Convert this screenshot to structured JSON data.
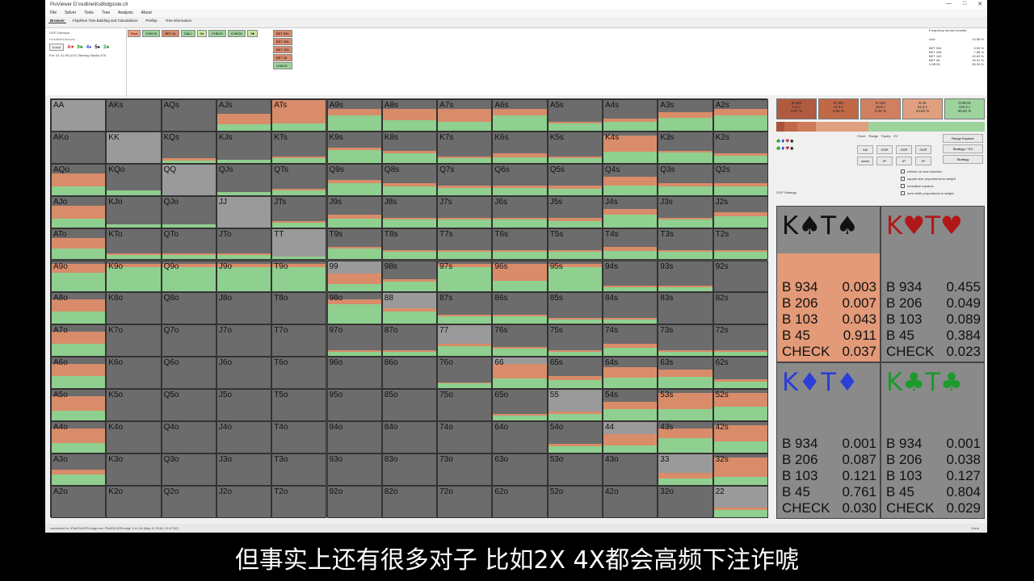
{
  "window": {
    "title": "PioViewer D:\\redline\\Ks8bdgsiste.cfr",
    "controls": [
      "—",
      "□",
      "✕"
    ]
  },
  "menu": [
    "File",
    "Solver",
    "Tools",
    "Tree",
    "Analysis",
    "About"
  ],
  "tabs": [
    "Browser",
    "Flop/Run Tree Building and Calculations",
    "Preflop",
    "Tree information"
  ],
  "left_info": {
    "line1": "OOP Decision",
    "line2": "r:0:c:b14:c:b:c:c:b",
    "board_button": "board",
    "board_cards": [
      "A♥",
      "9♣",
      "4♦",
      "5♠",
      "2♣"
    ],
    "pot_line": "Pot: 41 41 58 (157) Starting Stacks 876"
  },
  "action_sequence": [
    "Root",
    "CHECK",
    "BET 41",
    "CALL",
    "5♦",
    "CHECK",
    "CHECK",
    "2♣"
  ],
  "action_options": [
    "BET 934",
    "BET 206",
    "BET 103",
    "BET 45",
    "CHECK"
  ],
  "frequencies": {
    "header": "Frequency across runouts",
    "rows": [
      {
        "label": "Line",
        "value": "10.58 %"
      },
      {
        "label": "BET 934",
        "value": "0.09 %"
      },
      {
        "label": "BET 206",
        "value": "7.88 %"
      },
      {
        "label": "BET 103",
        "value": "10.63 %"
      },
      {
        "label": "BET 45",
        "value": "25.31 %"
      },
      {
        "label": "CHECK",
        "value": "55.33 %"
      }
    ]
  },
  "colors": {
    "bet": "#d98c6a",
    "check": "#8fcf8f",
    "neutral": "#7a7a7a"
  },
  "summary": [
    {
      "label": "B 934",
      "combos": "6.3 c",
      "pct": "3.97 %"
    },
    {
      "label": "B 206",
      "combos": "11.9 c",
      "pct": "5.56 %"
    },
    {
      "label": "B 103",
      "combos": "16.5 c",
      "pct": "9.25 %"
    },
    {
      "label": "B 45",
      "combos": "51.5 c",
      "pct": "24.62 %"
    },
    {
      "label": "CHECK",
      "combos": "118.3 c",
      "pct": "56.60 %"
    }
  ],
  "controls": {
    "labels": [
      "Clone",
      "Range",
      "Equity",
      "EV"
    ],
    "buttons": [
      "full",
      "OOP",
      "OOP",
      "OOP",
      "zoom",
      "IP",
      "IP",
      "IP"
    ],
    "side": [
      "Range Explorer",
      "Strategy + EV",
      "Strategy"
    ],
    "strategy_label": "OOP Strategy",
    "checkboxes": [
      "refresh on new selection",
      "square size proportional to weight",
      "normalize squares",
      "bars width proportional to weight"
    ]
  },
  "combos": [
    {
      "cards": "K♠T♠",
      "color": "#111111",
      "fill": 1.0,
      "rows": [
        [
          "B 934",
          "0.003"
        ],
        [
          "B 206",
          "0.007"
        ],
        [
          "B 103",
          "0.043"
        ],
        [
          "B 45",
          "0.911"
        ],
        [
          "CHECK",
          "0.037"
        ]
      ]
    },
    {
      "cards": "K♥T♥",
      "color": "#b01818",
      "fill": 0.0,
      "rows": [
        [
          "B 934",
          "0.455"
        ],
        [
          "B 206",
          "0.049"
        ],
        [
          "B 103",
          "0.089"
        ],
        [
          "B 45",
          "0.384"
        ],
        [
          "CHECK",
          "0.023"
        ]
      ]
    },
    {
      "cards": "K♦T♦",
      "color": "#2a3fd6",
      "fill": 0.0,
      "rows": [
        [
          "B 934",
          "0.001"
        ],
        [
          "B 206",
          "0.087"
        ],
        [
          "B 103",
          "0.121"
        ],
        [
          "B 45",
          "0.761"
        ],
        [
          "CHECK",
          "0.030"
        ]
      ]
    },
    {
      "cards": "K♣T♣",
      "color": "#1c9a2c",
      "fill": 0.0,
      "rows": [
        [
          "B 934",
          "0.001"
        ],
        [
          "B 206",
          "0.038"
        ],
        [
          "B 103",
          "0.127"
        ],
        [
          "B 45",
          "0.804"
        ],
        [
          "CHECK",
          "0.029"
        ]
      ]
    }
  ],
  "grid": {
    "ranks": [
      "A",
      "K",
      "Q",
      "J",
      "T",
      "9",
      "8",
      "7",
      "6",
      "5",
      "4",
      "3",
      "2"
    ],
    "cells": [
      [
        "AA",
        "AKs",
        "AQs",
        "AJs",
        "ATs",
        "A9s",
        "A8s",
        "A7s",
        "A6s",
        "A5s",
        "A4s",
        "A3s",
        "A2s"
      ],
      [
        "AKo",
        "KK",
        "KQs",
        "KJs",
        "KTs",
        "K9s",
        "K8s",
        "K7s",
        "K6s",
        "K5s",
        "K4s",
        "K3s",
        "K2s"
      ],
      [
        "AQo",
        "KQo",
        "QQ",
        "QJs",
        "QTs",
        "Q9s",
        "Q8s",
        "Q7s",
        "Q6s",
        "Q5s",
        "Q4s",
        "Q3s",
        "Q2s"
      ],
      [
        "AJo",
        "KJo",
        "QJo",
        "JJ",
        "JTs",
        "J9s",
        "J8s",
        "J7s",
        "J6s",
        "J5s",
        "J4s",
        "J3s",
        "J2s"
      ],
      [
        "ATo",
        "KTo",
        "QTo",
        "JTo",
        "TT",
        "T9s",
        "T8s",
        "T7s",
        "T6s",
        "T5s",
        "T4s",
        "T3s",
        "T2s"
      ],
      [
        "A9o",
        "K9o",
        "Q9o",
        "J9o",
        "T9o",
        "99",
        "98s",
        "97s",
        "96s",
        "95s",
        "94s",
        "93s",
        "92s"
      ],
      [
        "A8o",
        "K8o",
        "Q8o",
        "J8o",
        "T8o",
        "98o",
        "88",
        "87s",
        "86s",
        "85s",
        "84s",
        "83s",
        "82s"
      ],
      [
        "A7o",
        "K7o",
        "Q7o",
        "J7o",
        "T7o",
        "97o",
        "87o",
        "77",
        "76s",
        "75s",
        "74s",
        "73s",
        "72s"
      ],
      [
        "A6o",
        "K6o",
        "Q6o",
        "J6o",
        "T6o",
        "96o",
        "86o",
        "76o",
        "66",
        "65s",
        "64s",
        "63s",
        "62s"
      ],
      [
        "A5o",
        "K5o",
        "Q5o",
        "J5o",
        "T5o",
        "95o",
        "85o",
        "75o",
        "65o",
        "55",
        "54s",
        "53s",
        "52s"
      ],
      [
        "A4o",
        "K4o",
        "Q4o",
        "J4o",
        "T4o",
        "94o",
        "84o",
        "74o",
        "64o",
        "54o",
        "44",
        "43s",
        "42s"
      ],
      [
        "A3o",
        "K3o",
        "Q3o",
        "J3o",
        "T3o",
        "93o",
        "83o",
        "73o",
        "63o",
        "53o",
        "43o",
        "33",
        "32s"
      ],
      [
        "A2o",
        "K2o",
        "Q2o",
        "J2o",
        "T2o",
        "92o",
        "82o",
        "72o",
        "62o",
        "52o",
        "42o",
        "32o",
        "22"
      ]
    ],
    "mix": [
      [
        [
          0,
          0,
          0
        ],
        [
          0,
          0,
          0
        ],
        [
          0,
          0,
          0
        ],
        [
          0.6,
          0.4,
          0.55
        ],
        [
          1,
          0.3,
          1
        ],
        [
          0.3,
          0.7,
          0.7
        ],
        [
          0.5,
          0.5,
          0.7
        ],
        [
          0.6,
          0.4,
          0.7
        ],
        [
          0.3,
          0.7,
          0.7
        ],
        [
          0.2,
          0.6,
          0.3
        ],
        [
          0.2,
          0.6,
          0.4
        ],
        [
          0.3,
          0.7,
          0.6
        ],
        [
          0.3,
          0.7,
          0.7
        ]
      ],
      [
        [
          0,
          0,
          0
        ],
        [
          0,
          0,
          0
        ],
        [
          0.1,
          0.1,
          0.15
        ],
        [
          0,
          0.1,
          0.1
        ],
        [
          0.2,
          0.8,
          0.2
        ],
        [
          0.1,
          0.6,
          0.5
        ],
        [
          0.2,
          0.6,
          0.4
        ],
        [
          0.1,
          0.3,
          0.2
        ],
        [
          0.2,
          0.3,
          0.3
        ],
        [
          0.1,
          0.3,
          0.2
        ],
        [
          0.6,
          0.4,
          0.9
        ],
        [
          0.1,
          0.5,
          0.4
        ],
        [
          0.1,
          0.4,
          0.3
        ]
      ],
      [
        [
          0.6,
          0.4,
          0.7
        ],
        [
          0,
          0.1,
          0.15
        ],
        [
          0,
          0,
          0
        ],
        [
          0,
          0.1,
          0.1
        ],
        [
          0.1,
          0.3,
          0.2
        ],
        [
          0.2,
          0.6,
          0.5
        ],
        [
          0.2,
          0.5,
          0.4
        ],
        [
          0.1,
          0.4,
          0.3
        ],
        [
          0.1,
          0.4,
          0.3
        ],
        [
          0.2,
          0.4,
          0.3
        ],
        [
          0.5,
          0.5,
          0.6
        ],
        [
          0.2,
          0.5,
          0.4
        ],
        [
          0.2,
          0.5,
          0.4
        ]
      ],
      [
        [
          0.6,
          0.4,
          0.7
        ],
        [
          0,
          0.1,
          0.1
        ],
        [
          0,
          0.1,
          0.1
        ],
        [
          0,
          0,
          0
        ],
        [
          0.1,
          0.3,
          0.2
        ],
        [
          0.2,
          0.5,
          0.4
        ],
        [
          0.1,
          0.4,
          0.3
        ],
        [
          0.1,
          0.4,
          0.3
        ],
        [
          0.1,
          0.4,
          0.3
        ],
        [
          0.2,
          0.4,
          0.3
        ],
        [
          0.3,
          0.6,
          0.6
        ],
        [
          0.1,
          0.4,
          0.3
        ],
        [
          0.2,
          0.5,
          0.5
        ]
      ],
      [
        [
          0.5,
          0.5,
          0.7
        ],
        [
          0.1,
          0.2,
          0.2
        ],
        [
          0.1,
          0.2,
          0.2
        ],
        [
          0.1,
          0.2,
          0.2
        ],
        [
          0,
          0.1,
          0.1
        ],
        [
          0.1,
          0.6,
          0.4
        ],
        [
          0.1,
          0.5,
          0.3
        ],
        [
          0.1,
          0.4,
          0.3
        ],
        [
          0.1,
          0.5,
          0.3
        ],
        [
          0.1,
          0.4,
          0.3
        ],
        [
          0.2,
          0.5,
          0.4
        ],
        [
          0.1,
          0.4,
          0.3
        ],
        [
          0.1,
          0.5,
          0.3
        ]
      ],
      [
        [
          0.3,
          0.7,
          0.9
        ],
        [
          0.1,
          0.9,
          0.9
        ],
        [
          0.1,
          0.9,
          0.9
        ],
        [
          0.1,
          0.9,
          0.9
        ],
        [
          0.1,
          0.9,
          0.9
        ],
        [
          0.4,
          0.3,
          0.6
        ],
        [
          0.1,
          0.5,
          0.4
        ],
        [
          0.1,
          0.8,
          0.9
        ],
        [
          0.6,
          0.4,
          0.9
        ],
        [
          0.1,
          0.8,
          0.9
        ],
        [
          0.1,
          0.3,
          0.2
        ],
        [
          0.1,
          0.3,
          0.2
        ],
        [
          0,
          0,
          0
        ]
      ],
      [
        [
          0.5,
          0.5,
          0.8
        ],
        [
          0,
          0,
          0
        ],
        [
          0,
          0,
          0
        ],
        [
          0,
          0,
          0
        ],
        [
          0,
          0,
          0
        ],
        [
          0.2,
          0.8,
          0.8
        ],
        [
          0.1,
          0.5,
          0.5
        ],
        [
          0.1,
          0.4,
          0.3
        ],
        [
          0.1,
          0.4,
          0.3
        ],
        [
          0.1,
          0.3,
          0.2
        ],
        [
          0.1,
          0.3,
          0.2
        ],
        [
          0,
          0,
          0
        ],
        [
          0,
          0,
          0
        ]
      ],
      [
        [
          0.5,
          0.5,
          0.8
        ],
        [
          0,
          0,
          0
        ],
        [
          0,
          0,
          0
        ],
        [
          0,
          0,
          0
        ],
        [
          0,
          0,
          0
        ],
        [
          0.1,
          0.2,
          0.2
        ],
        [
          0.1,
          0.2,
          0.2
        ],
        [
          0.1,
          0.5,
          0.4
        ],
        [
          0.1,
          0.4,
          0.3
        ],
        [
          0.1,
          0.3,
          0.2
        ],
        [
          0.2,
          0.4,
          0.4
        ],
        [
          0.1,
          0.3,
          0.2
        ],
        [
          0.1,
          0.3,
          0.2
        ]
      ],
      [
        [
          0.5,
          0.5,
          0.8
        ],
        [
          0,
          0,
          0
        ],
        [
          0,
          0,
          0
        ],
        [
          0,
          0,
          0
        ],
        [
          0,
          0,
          0
        ],
        [
          0,
          0,
          0
        ],
        [
          0,
          0,
          0
        ],
        [
          0.1,
          0.3,
          0.2
        ],
        [
          0.6,
          0.4,
          0.8
        ],
        [
          0.2,
          0.4,
          0.4
        ],
        [
          0.5,
          0.5,
          0.7
        ],
        [
          0.4,
          0.6,
          0.6
        ],
        [
          0.2,
          0.5,
          0.3
        ]
      ],
      [
        [
          0.6,
          0.4,
          0.8
        ],
        [
          0,
          0,
          0
        ],
        [
          0,
          0,
          0
        ],
        [
          0,
          0,
          0
        ],
        [
          0,
          0,
          0
        ],
        [
          0,
          0,
          0
        ],
        [
          0,
          0,
          0
        ],
        [
          0,
          0,
          0
        ],
        [
          0.1,
          0.3,
          0.2
        ],
        [
          0.2,
          0.4,
          0.3
        ],
        [
          0.4,
          0.6,
          0.6
        ],
        [
          0.6,
          0.4,
          0.9
        ],
        [
          0.5,
          0.5,
          0.9
        ]
      ],
      [
        [
          0.6,
          0.4,
          0.8
        ],
        [
          0,
          0,
          0
        ],
        [
          0,
          0,
          0
        ],
        [
          0,
          0,
          0
        ],
        [
          0,
          0,
          0
        ],
        [
          0,
          0,
          0
        ],
        [
          0,
          0,
          0
        ],
        [
          0,
          0,
          0
        ],
        [
          0,
          0,
          0
        ],
        [
          0.2,
          0.4,
          0.3
        ],
        [
          0.6,
          0.4,
          0.6
        ],
        [
          0.4,
          0.6,
          0.8
        ],
        [
          0.6,
          0.4,
          0.9
        ]
      ],
      [
        [
          0.3,
          0.7,
          0.5
        ],
        [
          0,
          0,
          0
        ],
        [
          0,
          0,
          0
        ],
        [
          0,
          0,
          0
        ],
        [
          0,
          0,
          0
        ],
        [
          0,
          0,
          0
        ],
        [
          0,
          0,
          0
        ],
        [
          0,
          0,
          0
        ],
        [
          0,
          0,
          0
        ],
        [
          0,
          0,
          0
        ],
        [
          0,
          0,
          0
        ],
        [
          0.3,
          0.3,
          0.4
        ],
        [
          0.7,
          0.3,
          0.9
        ]
      ],
      [
        [
          0,
          0,
          0
        ],
        [
          0,
          0,
          0
        ],
        [
          0,
          0,
          0
        ],
        [
          0,
          0,
          0
        ],
        [
          0,
          0,
          0
        ],
        [
          0,
          0,
          0
        ],
        [
          0,
          0,
          0
        ],
        [
          0,
          0,
          0
        ],
        [
          0,
          0,
          0
        ],
        [
          0,
          0,
          0
        ],
        [
          0,
          0,
          0
        ],
        [
          0,
          0,
          0
        ],
        [
          0.1,
          0.3,
          0.3
        ]
      ]
    ]
  },
  "status": {
    "left": "connected to: \\PioSOLVER-edge.exe, PioSOLVER-edge 1.10.16 (May 11 2018, 21:47:52)",
    "right": "Done"
  },
  "subtitle": "但事实上还有很多对子 比如2X 4X都会高频下注诈唬"
}
